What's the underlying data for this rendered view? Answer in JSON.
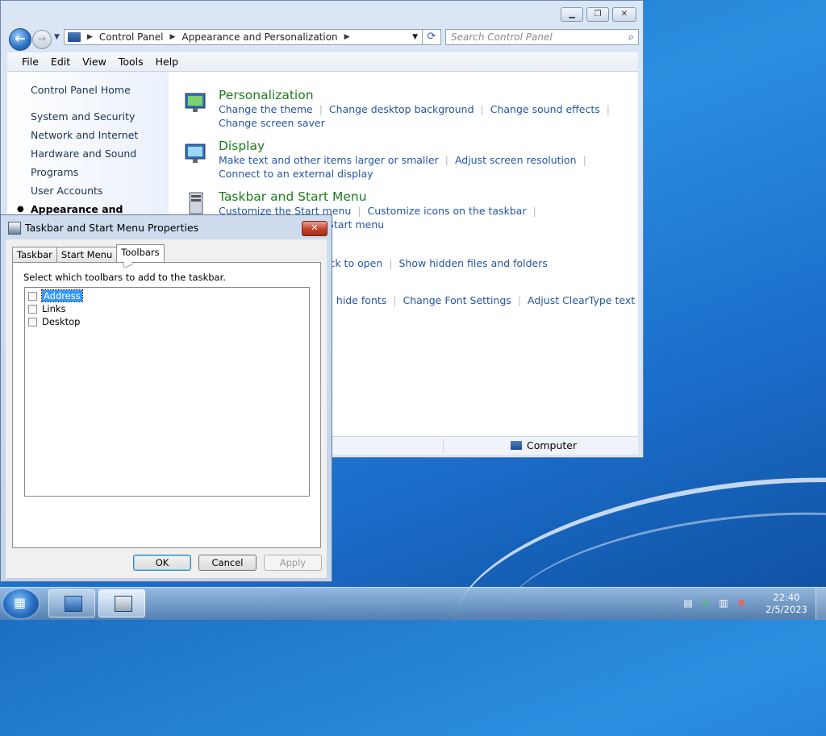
{
  "control_panel": {
    "address": {
      "crumbs": [
        "Control Panel",
        "Appearance and Personalization"
      ]
    },
    "search_placeholder": "Search Control Panel",
    "menu": [
      "File",
      "Edit",
      "View",
      "Tools",
      "Help"
    ],
    "sidebar": {
      "home": "Control Panel Home",
      "items": [
        "System and Security",
        "Network and Internet",
        "Hardware and Sound",
        "Programs",
        "User Accounts",
        "Appearance and"
      ]
    },
    "categories": [
      {
        "title": "Personalization",
        "links": [
          "Change the theme",
          "Change desktop background",
          "Change sound effects",
          "Change screen saver"
        ]
      },
      {
        "title": "Display",
        "links": [
          "Make text and other items larger or smaller",
          "Adjust screen resolution",
          "Connect to an external display"
        ]
      },
      {
        "title": "Taskbar and Start Menu",
        "links": [
          "Customize the Start menu",
          "Customize icons on the taskbar",
          "Start menu"
        ]
      }
    ],
    "partial_links": {
      "folder": [
        "ick to open",
        "Show hidden files and folders"
      ],
      "fonts": [
        "d hide fonts",
        "Change Font Settings",
        "Adjust ClearType text"
      ]
    },
    "status": "Computer"
  },
  "dialog": {
    "title": "Taskbar and Start Menu Properties",
    "tabs": [
      "Taskbar",
      "Start Menu",
      "Toolbars"
    ],
    "active_tab": "Toolbars",
    "description": "Select which toolbars to add to the taskbar.",
    "toolbars": [
      {
        "label": "Address",
        "checked": false,
        "selected": true
      },
      {
        "label": "Links",
        "checked": false,
        "selected": false
      },
      {
        "label": "Desktop",
        "checked": false,
        "selected": false
      }
    ],
    "buttons": {
      "ok": "OK",
      "cancel": "Cancel",
      "apply": "Apply"
    }
  },
  "taskbar": {
    "clock_time": "22:40",
    "clock_date": "2/5/2023"
  }
}
